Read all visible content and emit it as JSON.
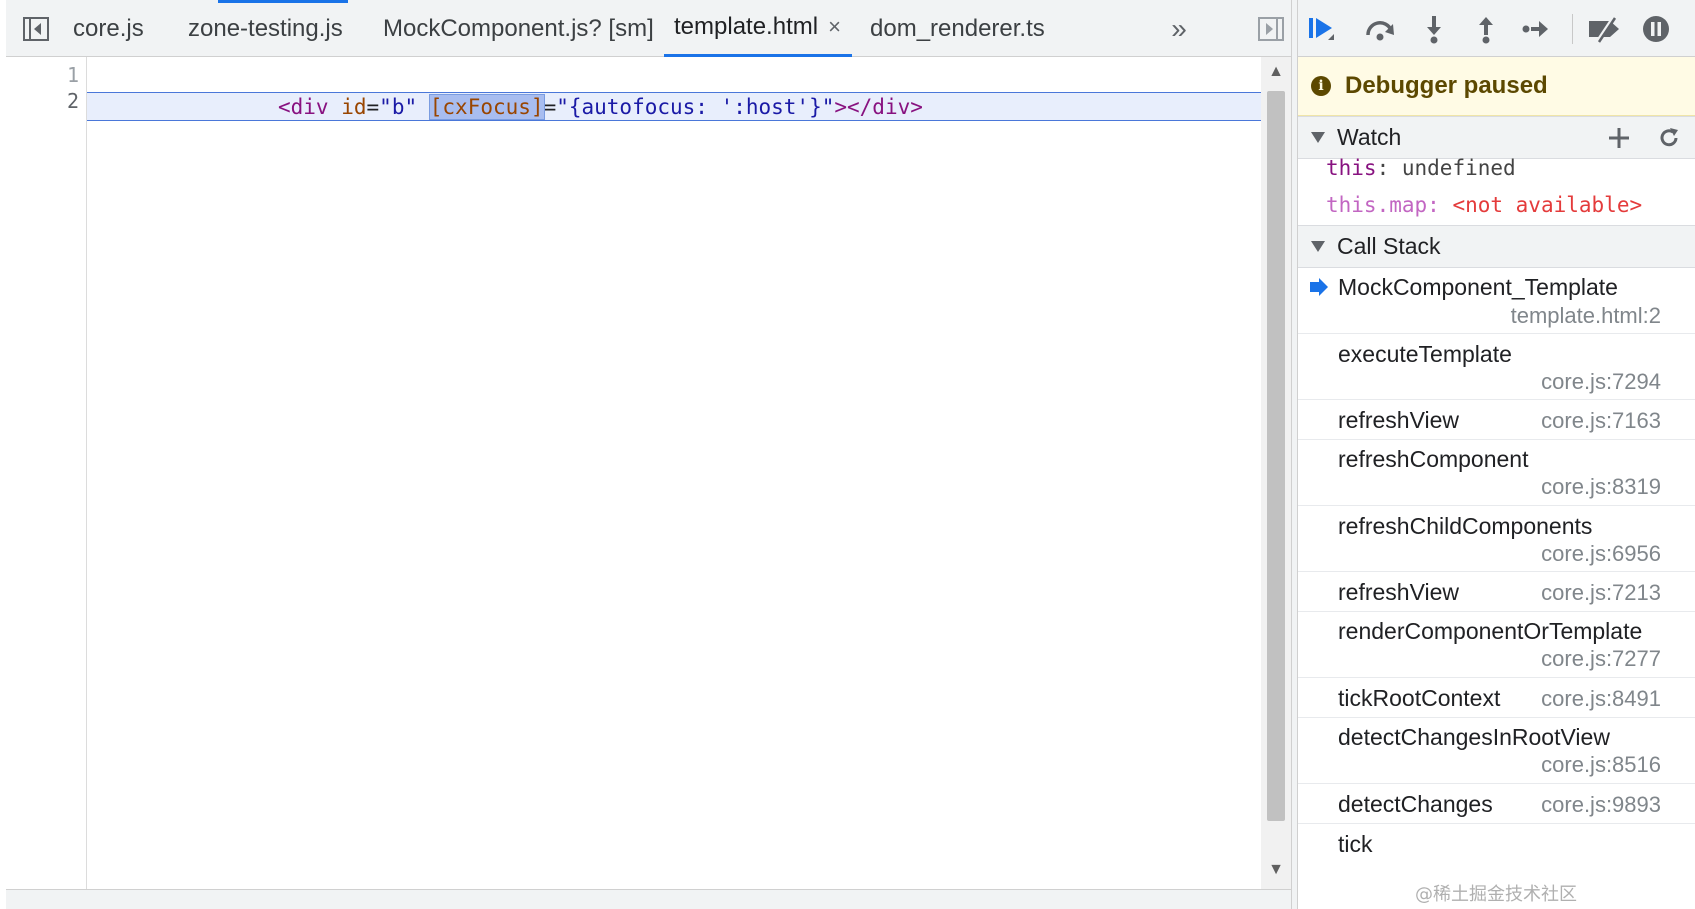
{
  "editor": {
    "tabs": [
      {
        "label": "core.js"
      },
      {
        "label": "zone-testing.js"
      },
      {
        "label": "MockComponent.js? [sm]"
      },
      {
        "label": "template.html",
        "close": "×"
      },
      {
        "label": "dom_renderer.ts"
      }
    ],
    "more_tabs": "»",
    "line_numbers": [
      "1",
      "2"
    ],
    "code": {
      "t1": "<div ",
      "t2": "id",
      "t3": "=",
      "t4": "\"b\"",
      "t5": " ",
      "t6": "[cxFocus]",
      "t7": "=",
      "t8": "\"{autofocus: ':host'}\"",
      "t9": "></div>"
    }
  },
  "debugger": {
    "banner": "Debugger paused",
    "watch": {
      "title": "Watch",
      "rows": [
        {
          "key": "this",
          "sep": ": ",
          "value": "undefined"
        },
        {
          "key": "this.map",
          "sep": ": ",
          "value": "<not available>"
        }
      ]
    },
    "call_stack": {
      "title": "Call Stack",
      "frames": [
        {
          "name": "MockComponent_Template",
          "location": "template.html:2"
        },
        {
          "name": "executeTemplate",
          "location": "core.js:7294"
        },
        {
          "name": "refreshView",
          "location": "core.js:7163"
        },
        {
          "name": "refreshComponent",
          "location": "core.js:8319"
        },
        {
          "name": "refreshChildComponents",
          "location": "core.js:6956"
        },
        {
          "name": "refreshView",
          "location": "core.js:7213"
        },
        {
          "name": "renderComponentOrTemplate",
          "location": "core.js:7277"
        },
        {
          "name": "tickRootContext",
          "location": "core.js:8491"
        },
        {
          "name": "detectChangesInRootView",
          "location": "core.js:8516"
        },
        {
          "name": "detectChanges",
          "location": "core.js:9893"
        },
        {
          "name": "tick",
          "location": ""
        }
      ]
    }
  },
  "watermark": "@稀土掘金技术社区",
  "colors": {
    "accent": "#1a73e8",
    "paused_bg": "#fffbe5",
    "paused_text": "#5c4800"
  }
}
